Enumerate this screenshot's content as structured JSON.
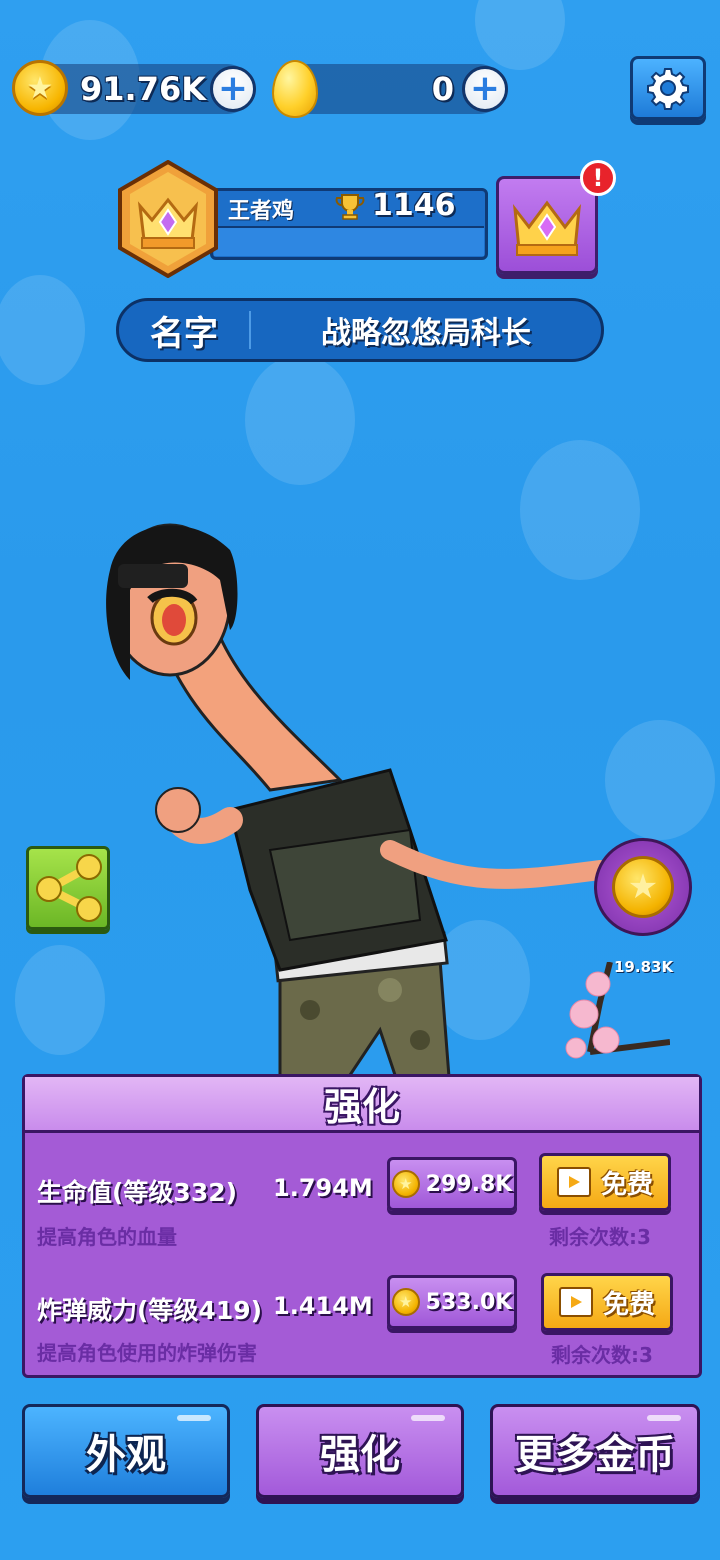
{
  "currency": {
    "coins_value": "91.76K",
    "eggs_value": "0"
  },
  "rank": {
    "title": "王者鸡",
    "trophies": "1146"
  },
  "profile": {
    "name_label": "名字",
    "name_value": "战略忽悠局科长"
  },
  "alert": {
    "mark": "!"
  },
  "pickup": {
    "value": "19.83K"
  },
  "upgrade_panel": {
    "title": "强化",
    "items": [
      {
        "name": "生命值(等级332)",
        "value": "1.794M",
        "description": "提高角色的血量",
        "cost": "299.8K",
        "free_label": "免费",
        "remaining": "剩余次数:3"
      },
      {
        "name": "炸弹威力(等级419)",
        "value": "1.414M",
        "description": "提高角色使用的炸弹伤害",
        "cost": "533.0K",
        "free_label": "免费",
        "remaining": "剩余次数:3"
      }
    ]
  },
  "nav": {
    "appearance": "外观",
    "upgrade": "强化",
    "more_coins": "更多金币"
  },
  "colors": {
    "background": "#2c9ff0",
    "panel_purple": "#a45bd6",
    "free_button": "#f5a915",
    "nav_blue": "#1f7fdc"
  }
}
